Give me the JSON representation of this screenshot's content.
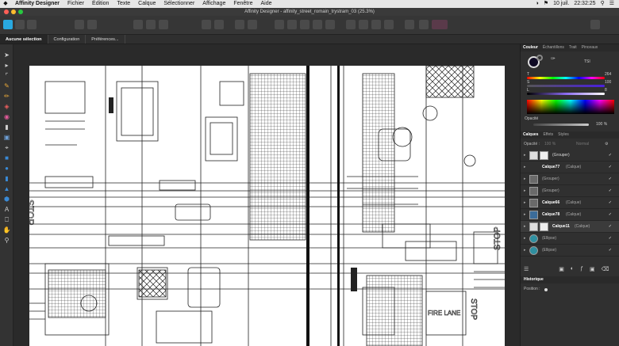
{
  "menubar": {
    "app": "Affinity Designer",
    "items": [
      "Fichier",
      "Édition",
      "Texte",
      "Calque",
      "Sélectionner",
      "Affichage",
      "Fenêtre",
      "Aide"
    ],
    "date": "10 juil.",
    "time": "22:32:25"
  },
  "window": {
    "title": "Affinity Designer - affinity_street_romain_trystram_03 (25.3%)"
  },
  "context": {
    "tabs": [
      "Aucune sélection",
      "Configuration",
      "Préférences..."
    ]
  },
  "colour_panel": {
    "tabs": [
      "Couleur",
      "Échantillons",
      "Trait",
      "Pinceaux"
    ],
    "mode": "TSI",
    "h_label": "T",
    "h_value": "264",
    "s_label": "S",
    "s_value": "100",
    "l_label": "L",
    "l_value": "8",
    "opacity_label": "Opacité",
    "opacity_value": "100 %",
    "h_fill": 0.73,
    "s_fill": 1.0,
    "l_fill": 0.08,
    "fill_color": "#0f0a24"
  },
  "layers_panel": {
    "tabs": [
      "Calques",
      "Effets",
      "Styles"
    ],
    "opacity_label": "Opacité :",
    "opacity_value": "100 %",
    "blend": "Normal",
    "rows": [
      {
        "name": "(Grouper)",
        "bold": false,
        "thumb": "light"
      },
      {
        "name": "Calque77",
        "suffix": " (Calque)",
        "bold": true,
        "thumb": "none"
      },
      {
        "name": "(Grouper)",
        "bold": false,
        "thumb": "dark"
      },
      {
        "name": "(Grouper)",
        "bold": false,
        "thumb": "dark"
      },
      {
        "name": "Calque66",
        "suffix": " (Calque)",
        "bold": true,
        "thumb": "dark"
      },
      {
        "name": "Calque78",
        "suffix": " (Calque)",
        "bold": true,
        "thumb": "blue"
      },
      {
        "name": "Calque11",
        "suffix": " (Calque)",
        "bold": true,
        "thumb": "light"
      },
      {
        "name": "(Ellipse)",
        "bold": false,
        "thumb": "teal"
      },
      {
        "name": "(Ellipse)",
        "bold": false,
        "thumb": "teal"
      }
    ]
  },
  "history_panel": {
    "title": "Historique",
    "position_label": "Position :"
  },
  "canvas": {
    "texts": [
      "STOP",
      "STOP",
      "STOP",
      "FIRE LANE"
    ]
  },
  "colors": {
    "accent": "#3b83c6",
    "bg": "#2b2b2b",
    "panel": "#303030"
  }
}
